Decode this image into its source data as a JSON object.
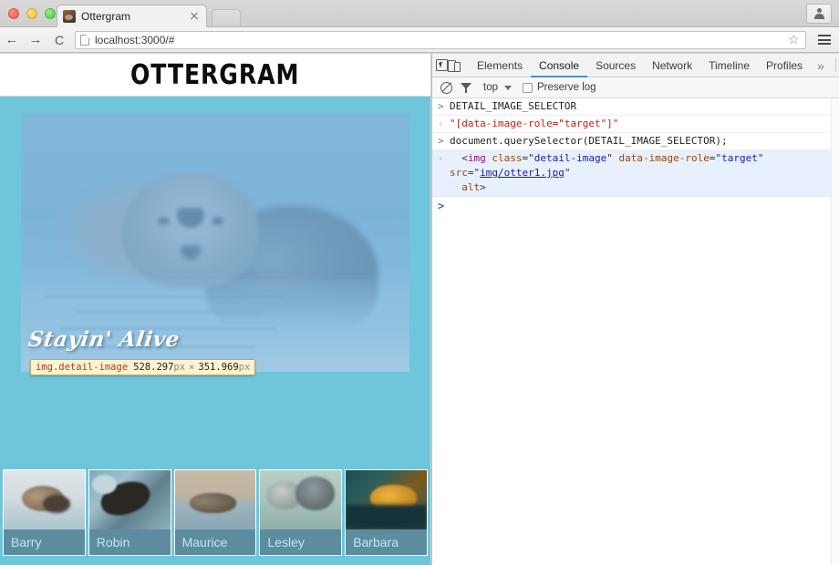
{
  "browser": {
    "window_controls": [
      "close",
      "minimize",
      "zoom"
    ],
    "tab": {
      "title": "Ottergram",
      "favicon": "otter-favicon",
      "close_label": "×"
    },
    "new_tab_label": "",
    "profile_icon": "person-icon",
    "nav": {
      "back_icon": "←",
      "forward_icon": "→",
      "reload_icon": "↻",
      "reload_glyph": "C",
      "page_icon": "page-icon",
      "url": "localhost:3000/#",
      "star_icon": "☆",
      "menu_icon": "hamburger-menu-icon"
    }
  },
  "page": {
    "title": "OTTERGRAM",
    "background_color": "#6fc5da",
    "detail": {
      "caption": "Stayin' Alive",
      "highlight_color": "#6fa8dc",
      "badge": {
        "selector": "img.detail-image",
        "width": "528.297",
        "height": "351.969",
        "unit": "px",
        "separator": "×"
      }
    },
    "thumbnails": [
      {
        "name": "Barry",
        "art": "art-1"
      },
      {
        "name": "Robin",
        "art": "art-2"
      },
      {
        "name": "Maurice",
        "art": "art-3"
      },
      {
        "name": "Lesley",
        "art": "art-4"
      },
      {
        "name": "Barbara",
        "art": "art-5"
      }
    ]
  },
  "devtools": {
    "toolbar": {
      "inspect_icon": "inspect-element-icon",
      "device_icon": "device-toolbar-icon",
      "tabs": [
        {
          "label": "Elements",
          "active": false
        },
        {
          "label": "Console",
          "active": true
        },
        {
          "label": "Sources",
          "active": false
        },
        {
          "label": "Network",
          "active": false
        },
        {
          "label": "Timeline",
          "active": false
        },
        {
          "label": "Profiles",
          "active": false
        }
      ],
      "more_tabs_label": "»",
      "menu_icon": "more-options-icon",
      "close_icon": "close-devtools-icon"
    },
    "filterbar": {
      "clear_icon": "clear-console-icon",
      "filter_icon": "filter-icon",
      "context": "top",
      "preserve_log_label": "Preserve log",
      "preserve_log_checked": false
    },
    "console": {
      "lines": [
        {
          "gutter": ">",
          "kind": "input",
          "text": "DETAIL_IMAGE_SELECTOR"
        },
        {
          "gutter": "‹",
          "kind": "output-string",
          "text": "\"[data-image-role=\"target\"]\""
        },
        {
          "gutter": ">",
          "kind": "input",
          "text": "document.querySelector(DETAIL_IMAGE_SELECTOR);"
        },
        {
          "gutter": "‹",
          "kind": "output-node",
          "node": {
            "tag": "img",
            "attrs": [
              {
                "name": "class",
                "value": "detail-image"
              },
              {
                "name": "data-image-role",
                "value": "target"
              },
              {
                "name": "src",
                "value": "img/otter1.jpg",
                "link": true
              }
            ],
            "bare_attrs": [
              "alt"
            ]
          }
        }
      ],
      "prompt": ">"
    }
  }
}
